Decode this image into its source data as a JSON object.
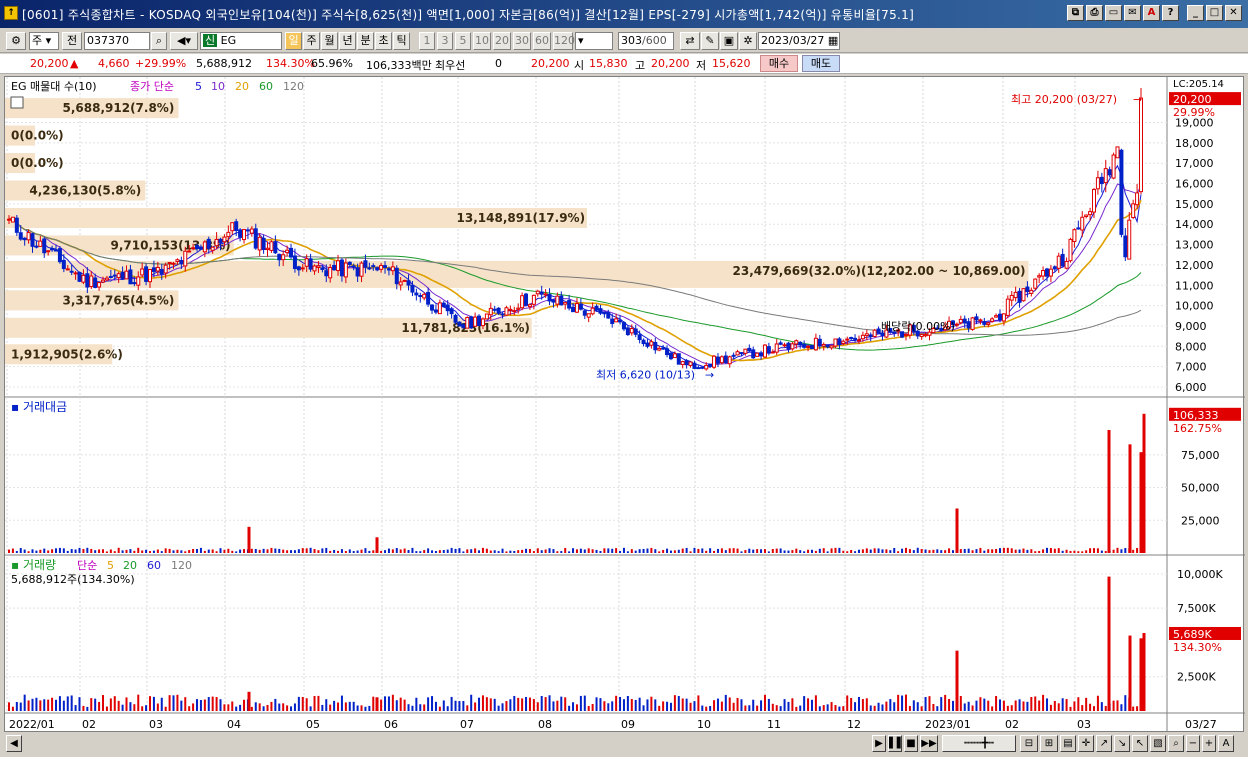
{
  "window": {
    "title": "[0601] 주식종합차트 - KOSDAQ 외국인보유[104(천)] 주식수[8,625(천)] 액면[1,000] 자본금[86(억)] 결산[12월] EPS[-279] 시가총액[1,742(억)] 유통비율[75.1]",
    "icon": "chart-app-icon"
  },
  "toolbar": {
    "market_select": "주",
    "market_label": "전",
    "code": "037370",
    "stock_name": "EG",
    "stock_prefix": "신",
    "periods": [
      "일",
      "주",
      "월",
      "년",
      "분",
      "초",
      "틱"
    ],
    "active_period": "일",
    "intervals": [
      "1",
      "3",
      "5",
      "10",
      "20",
      "30",
      "60",
      "120"
    ],
    "count": "303",
    "count_max": "/600",
    "date": "2023/03/27"
  },
  "info": {
    "price": "20,200",
    "change": "4,660",
    "change_pct": "+29.99%",
    "volume": "5,688,912",
    "vol_ratio": "134.30%",
    "turnover": "65.96%",
    "amount": "106,333백만",
    "priority_label": "최우선",
    "priority_value": "0",
    "ask": "20,200",
    "open_label": "시",
    "open": "15,830",
    "high_label": "고",
    "high": "20,200",
    "low_label": "저",
    "low": "15,620",
    "buy_label": "매수",
    "sell_label": "매도"
  },
  "price_panel": {
    "legend_name": "EG 매물대 수(10)",
    "legend_ma": "종가 단순",
    "ma_periods": [
      "5",
      "10",
      "20",
      "60",
      "120"
    ],
    "ma_colors": [
      "#1b1bd6",
      "#7a2bd0",
      "#e0a000",
      "#1a9a2a",
      "#7a7a7a"
    ],
    "current_tag": "20,200",
    "current_pct": "29.99%",
    "top_label": "LC:205.14",
    "high_note": "최고 20,200 (03/27)",
    "low_note": "최저 6,620 (10/13)",
    "dividend_note": "배당락(0.00%)",
    "volume_profile": [
      {
        "label": "5,688,912(7.8%)",
        "price_from": 19500,
        "price_to": 20200,
        "share": 0.13
      },
      {
        "label": "0(0.0%)",
        "price_from": 18150,
        "price_to": 18850,
        "share": 0
      },
      {
        "label": "0(0.0%)",
        "price_from": 16800,
        "price_to": 17500,
        "share": 0
      },
      {
        "label": "4,236,130(5.8%)",
        "price_from": 15450,
        "price_to": 16150,
        "share": 0.1
      },
      {
        "label": "13,148,891(17.9%)",
        "price_from": 14100,
        "price_to": 14800,
        "share": 0.5
      },
      {
        "label": "9,710,153(13.3%)",
        "price_from": 12750,
        "price_to": 13450,
        "share": 0.18
      },
      {
        "label": "23,479,669(32.0%)(12,202.00 ~ 10,869.00)",
        "price_from": 10870,
        "price_to": 12200,
        "share": 0.9
      },
      {
        "label": "3,317,765(4.5%)",
        "price_from": 10050,
        "price_to": 10750,
        "share": 0.13
      },
      {
        "label": "11,781,823(16.1%)",
        "price_from": 8700,
        "price_to": 9400,
        "share": 0.45
      },
      {
        "label": "1,912,905(2.6%)",
        "price_from": 7400,
        "price_to": 8100,
        "share": 0.07
      }
    ],
    "y_ticks": [
      "19,000",
      "18,000",
      "17,000",
      "16,000",
      "15,000",
      "14,000",
      "13,000",
      "12,000",
      "11,000",
      "10,000",
      "9,000",
      "8,000",
      "7,000",
      "6,000"
    ]
  },
  "amount_panel": {
    "legend": "거래대금",
    "current_tag": "106,333",
    "current_pct": "162.75%",
    "y_ticks": [
      "75,000",
      "50,000",
      "25,000"
    ]
  },
  "volume_panel": {
    "legend": "거래량",
    "legend_ma": "단순",
    "ma_periods": [
      "5",
      "20",
      "60",
      "120"
    ],
    "value_note": "5,688,912주(134.30%)",
    "current_tag": "5,689K",
    "current_pct": "134.30%",
    "y_ticks": [
      "10,000K",
      "7,500K",
      "2,500K"
    ]
  },
  "x_axis": {
    "labels": [
      "2022/01",
      "02",
      "03",
      "04",
      "05",
      "06",
      "07",
      "08",
      "09",
      "10",
      "11",
      "12",
      "2023/01",
      "02",
      "03"
    ],
    "end_label": "03/27"
  },
  "colors": {
    "up": "#e00000",
    "down": "#0020c8",
    "profile": "#f5e2c8",
    "title_bar": "#0a246a"
  },
  "chart_data": [
    {
      "type": "line",
      "title": "",
      "series": [
        {
          "name": "종가",
          "x": [
            "2022/01",
            "2022/02",
            "2022/03",
            "2022/04",
            "2022/05",
            "2022/06",
            "2022/07",
            "2022/08",
            "2022/09",
            "2022/10",
            "2022/11",
            "2022/12",
            "2023/01",
            "2023/02",
            "2023/03",
            "2023/03/27"
          ],
          "values": [
            14100,
            11200,
            11600,
            13800,
            11800,
            11800,
            9000,
            10500,
            9300,
            7000,
            7800,
            8300,
            8800,
            9200,
            12500,
            20200
          ]
        }
      ],
      "ylim": [
        6000,
        20500
      ],
      "high": {
        "date": "03/27",
        "value": 20200
      },
      "low": {
        "date": "10/13",
        "value": 6620
      }
    },
    {
      "type": "bar",
      "title": "",
      "series": [
        {
          "name": "거래대금",
          "x": [
            "2022/04",
            "2022/06",
            "2023/01",
            "2023/03(a)",
            "2023/03(b)",
            "2023/03(c)",
            "2023/03/27"
          ],
          "values": [
            20000,
            12000,
            34000,
            94000,
            83000,
            77000,
            106333
          ]
        }
      ],
      "ylim": [
        0,
        110000
      ]
    },
    {
      "type": "bar",
      "title": "",
      "series": [
        {
          "name": "거래량",
          "x": [
            "2022/04",
            "2022/06",
            "2023/01",
            "2023/03(a)",
            "2023/03(b)",
            "2023/03(c)",
            "2023/03/27"
          ],
          "values": [
            1400,
            1000,
            4400,
            9800,
            5500,
            5300,
            5689
          ]
        }
      ],
      "ylim": [
        0,
        10500
      ]
    }
  ]
}
